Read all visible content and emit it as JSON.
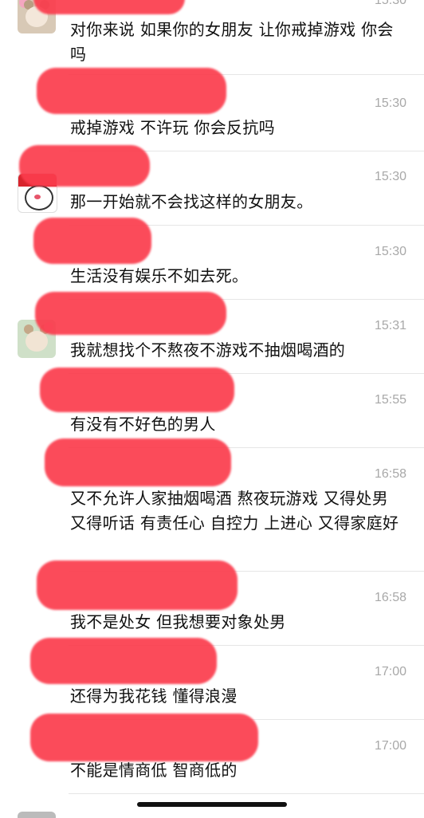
{
  "messages": [
    {
      "time": "15:30",
      "text": "对你来说 如果你的女朋友 让你戒掉游戏 你会吗"
    },
    {
      "time": "15:30",
      "text": "戒掉游戏 不许玩 你会反抗吗"
    },
    {
      "time": "15:30",
      "text": "那一开始就不会找这样的女朋友。"
    },
    {
      "time": "15:30",
      "text": "生活没有娱乐不如去死。"
    },
    {
      "time": "15:31",
      "text": "我就想找个不熬夜不游戏不抽烟喝酒的"
    },
    {
      "time": "15:55",
      "text": "有没有不好色的男人"
    },
    {
      "time": "16:58",
      "text": "又不允许人家抽烟喝酒 熬夜玩游戏 又得处男 又得听话 有责任心 自控力 上进心 又得家庭好"
    },
    {
      "time": "16:58",
      "text": "我不是处女 但我想要对象处男"
    },
    {
      "time": "17:00",
      "text": "还得为我花钱 懂得浪漫"
    },
    {
      "time": "17:00",
      "text": "不能是情商低 智商低的"
    }
  ],
  "colors": {
    "redaction": "#fb3c4d",
    "time": "#a8a8a8",
    "text": "#111111"
  },
  "icons": [
    "avatar-bear-icon",
    "avatar-mouse-icon",
    "avatar-bear2-icon"
  ]
}
